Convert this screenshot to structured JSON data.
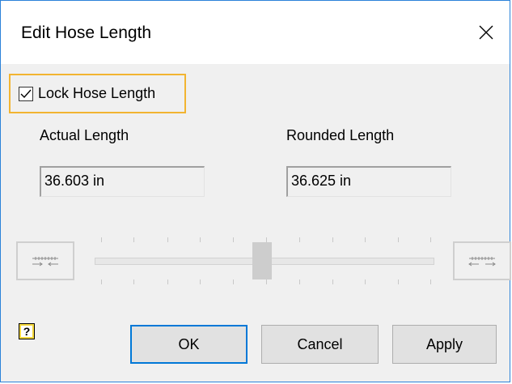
{
  "dialog": {
    "title": "Edit Hose Length",
    "close_icon": "close-icon"
  },
  "lock": {
    "label": "Lock Hose Length",
    "checked": true
  },
  "actual": {
    "label": "Actual Length",
    "value": "36.603 in"
  },
  "rounded": {
    "label": "Rounded Length",
    "value": "36.625 in"
  },
  "slider": {
    "shorten_icon": "decrease-length-icon",
    "lengthen_icon": "increase-length-icon",
    "position": 0.5
  },
  "buttons": {
    "help_icon": "help-icon",
    "help_glyph": "?",
    "ok": "OK",
    "cancel": "Cancel",
    "apply": "Apply"
  },
  "colors": {
    "accent": "#0078d7",
    "highlight": "#f2b431"
  }
}
